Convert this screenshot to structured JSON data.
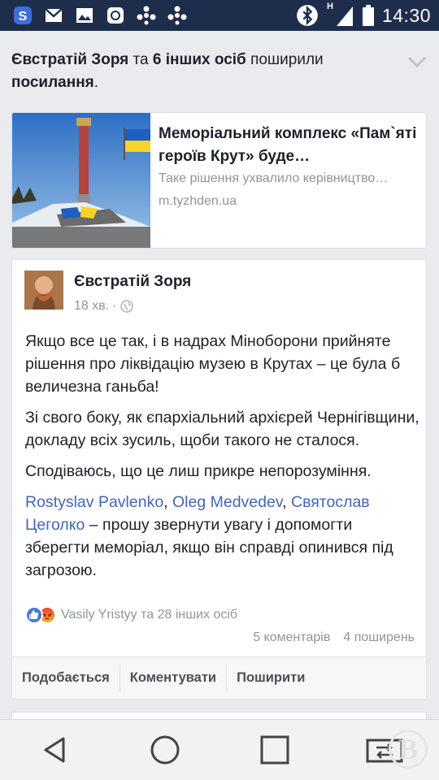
{
  "status_bar": {
    "time": "14:30",
    "signal_label": "H",
    "icons": [
      "s-app-icon",
      "gmail-icon",
      "gallery-icon",
      "viber-icon",
      "pinwheel-icon",
      "pinwheel-icon",
      "bluetooth-icon",
      "signal-icon",
      "battery-icon"
    ]
  },
  "share_header": {
    "actor": "Євстратій Зоря",
    "conj": " та ",
    "others": "6 інших осіб",
    "verb": " поширили ",
    "object": "посилання",
    "period": "."
  },
  "link_card": {
    "title": "Меморіальний комплекс «Пам`яті героїв Крут» буде…",
    "description": "Таке рішення ухвалило керівництво…",
    "domain": "m.tyzhden.ua"
  },
  "post": {
    "author": "Євстратій Зоря",
    "time": "18 хв.",
    "dot": "·",
    "paragraphs": [
      "Якщо все це так, і в надрах Міноборони прийняте рішення про ліквідацію музею в Крутах – це була б величезна ганьба!",
      "Зі свого боку, як єпархіальний архієрей Чернігівщини, докладу всіх зусиль, щоби такого не сталося.",
      "Сподіваюсь, що це лиш прикре непорозуміння."
    ],
    "mentions": [
      "Rostyslav Pavlenko",
      "Oleg Medvedev",
      "Святослав Цеголко"
    ],
    "mention_sep_1": ", ",
    "mention_sep_2": ", ",
    "mention_tail": " – прошу звернути увагу і допомогти зберегти меморіал, якщо він справді опинився під загрозою.",
    "reactions_text": "Vasily Yristyy та 28 інших осіб",
    "comments": "5 коментарів",
    "shares": "4 поширень",
    "actions": {
      "like": "Подобається",
      "comment": "Коментувати",
      "share": "Поширити"
    }
  },
  "colors": {
    "status_bar": "#1f2d4d",
    "link": "#4267b2",
    "muted": "#90949c",
    "text": "#1d2129",
    "background": "#e9ebee"
  },
  "watermark": "В"
}
